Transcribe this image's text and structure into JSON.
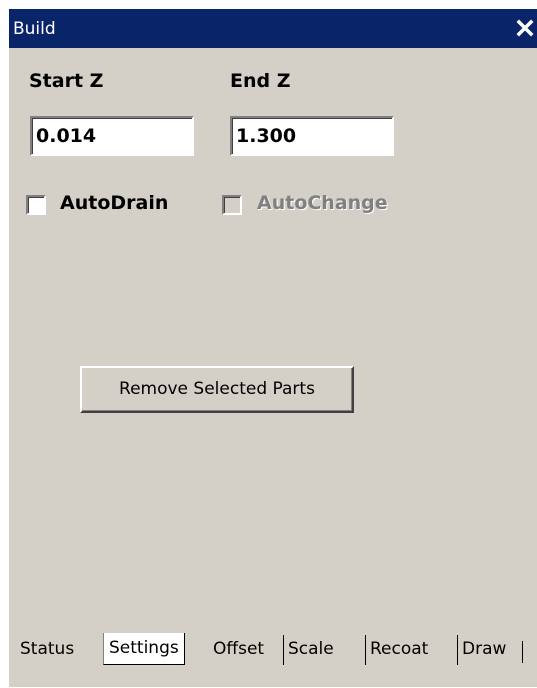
{
  "window": {
    "title": "Build",
    "close_icon": "close-icon"
  },
  "fields": {
    "start_z_label": "Start Z",
    "start_z_value": "0.014",
    "end_z_label": "End Z",
    "end_z_value": "1.300"
  },
  "options": {
    "auto_drain_label": "AutoDrain",
    "auto_drain_checked": false,
    "auto_change_label": "AutoChange",
    "auto_change_checked": false,
    "auto_change_enabled": false
  },
  "actions": {
    "remove_selected_parts_label": "Remove Selected Parts"
  },
  "tabs": [
    {
      "label": "Status",
      "active": false
    },
    {
      "label": "Settings",
      "active": true
    },
    {
      "label": "Offset",
      "active": false
    },
    {
      "label": "Scale",
      "active": false
    },
    {
      "label": "Recoat",
      "active": false
    },
    {
      "label": "Draw",
      "active": false
    }
  ],
  "colors": {
    "titlebar": "#0a246a",
    "panel": "#d4d0c8",
    "disabled_text": "#808080"
  }
}
